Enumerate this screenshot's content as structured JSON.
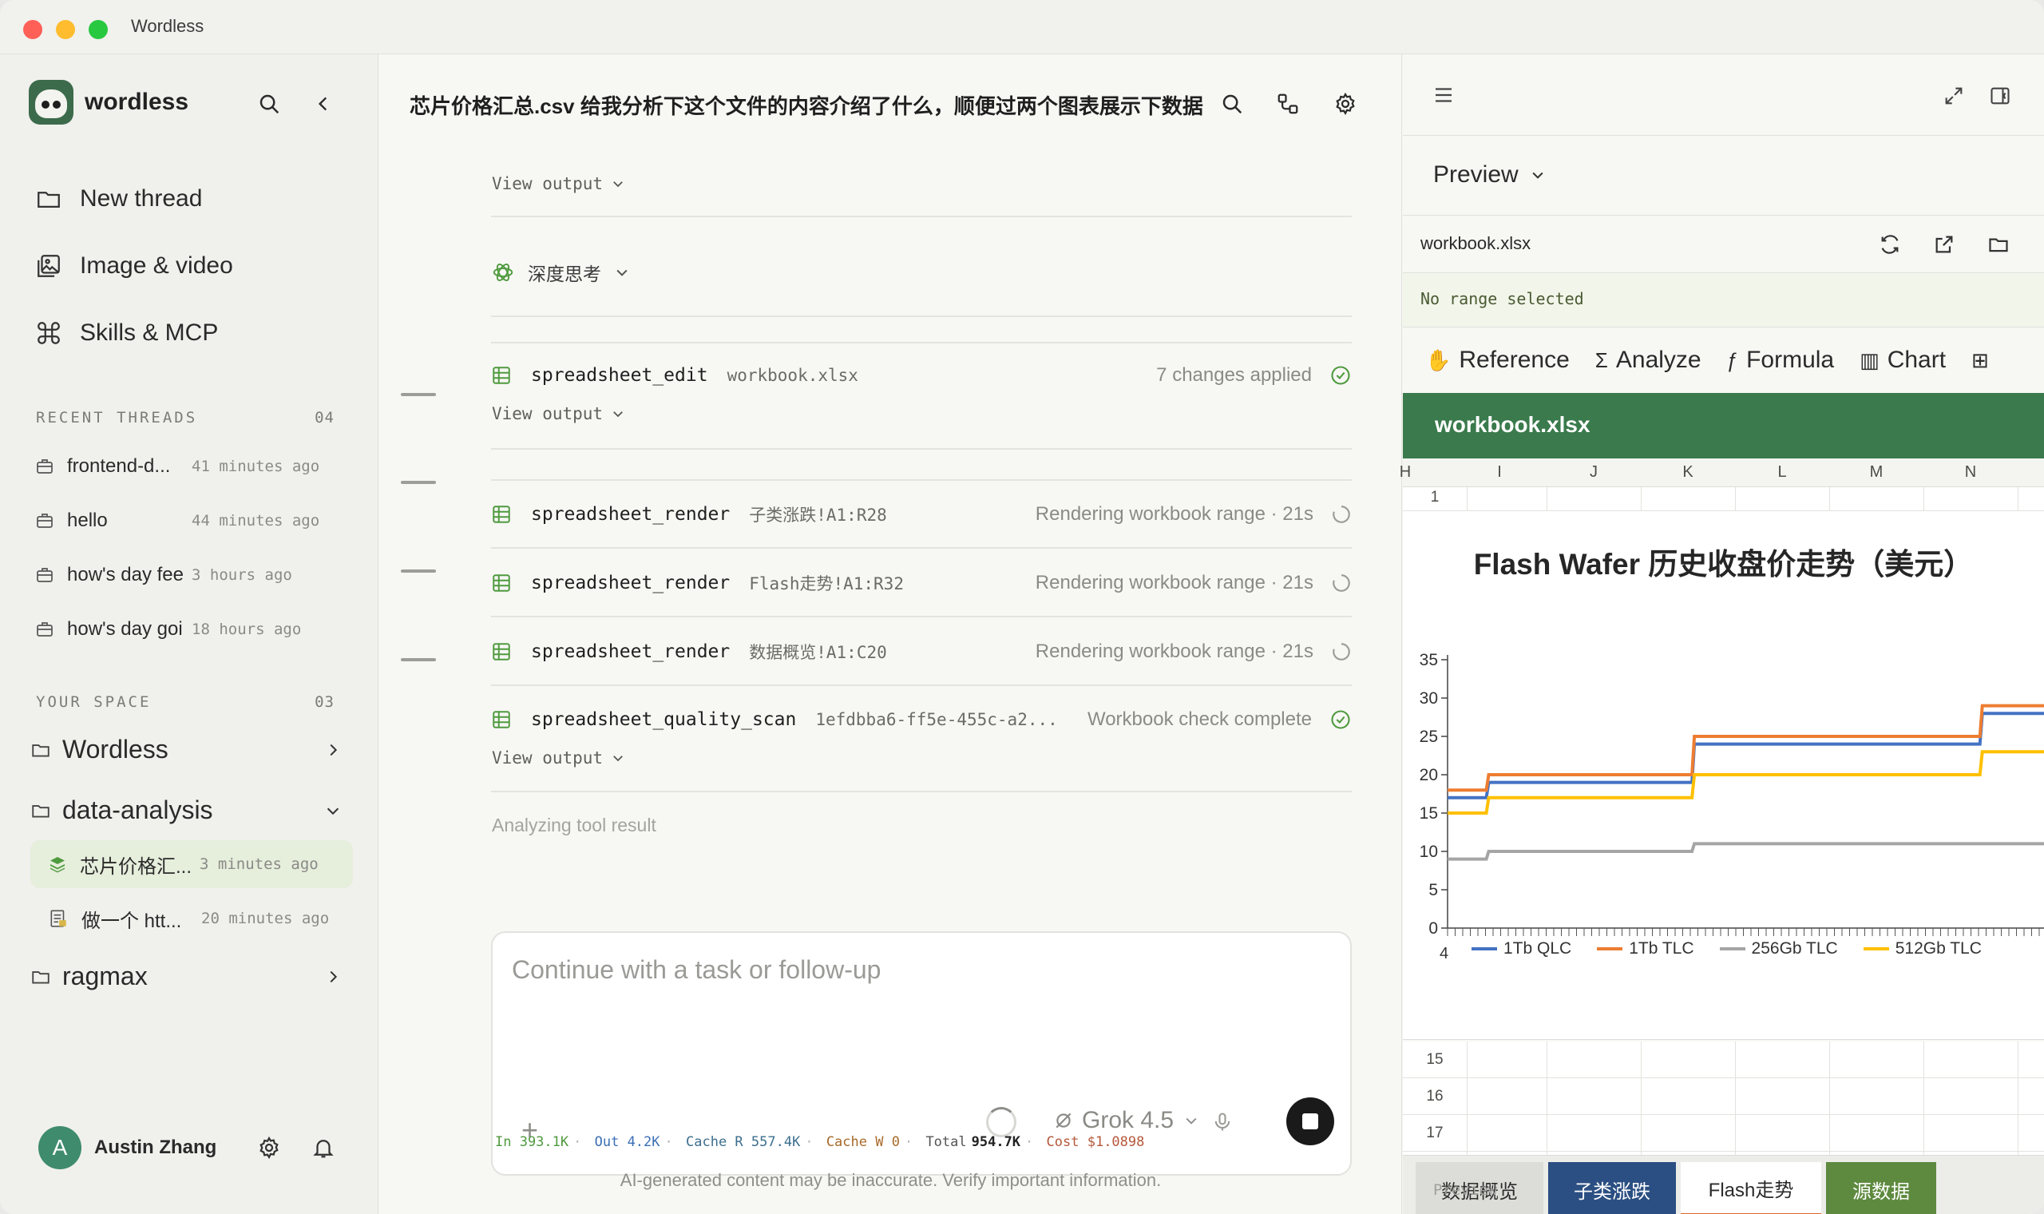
{
  "window": {
    "title": "Wordless"
  },
  "sidebar": {
    "brand": "wordless",
    "nav": [
      {
        "label": "New thread",
        "icon": "folder-icon"
      },
      {
        "label": "Image & video",
        "icon": "image-icon"
      },
      {
        "label": "Skills & MCP",
        "icon": "command-icon"
      }
    ],
    "recent": {
      "heading": "RECENT THREADS",
      "count": "04",
      "items": [
        {
          "name": "frontend-d...",
          "time": "41 minutes ago"
        },
        {
          "name": "hello",
          "time": "44 minutes ago"
        },
        {
          "name": "how's day feeli...",
          "time": "3 hours ago"
        },
        {
          "name": "how's day goi...",
          "time": "18 hours ago"
        }
      ]
    },
    "space": {
      "heading": "YOUR SPACE",
      "count": "03",
      "items": [
        {
          "name": "Wordless"
        },
        {
          "name": "data-analysis"
        },
        {
          "name": "ragmax"
        }
      ],
      "sub": [
        {
          "name": "芯片价格汇...",
          "time": "3 minutes ago"
        },
        {
          "name": "做一个 htt...",
          "time": "20 minutes ago"
        }
      ]
    },
    "user": {
      "initial": "A",
      "name": "Austin Zhang"
    }
  },
  "main": {
    "title": "芯片价格汇总.csv 给我分析下这个文件的内容介绍了什么，顺便过两个图表展示下数据",
    "view_output": "View output",
    "thinking": "深度思考",
    "tools": [
      {
        "name": "spreadsheet_edit",
        "arg": "workbook.xlsx",
        "status": "7 changes applied"
      },
      {
        "name": "spreadsheet_render",
        "arg": "子类涨跌!A1:R28",
        "status": "Rendering workbook range · 21s"
      },
      {
        "name": "spreadsheet_render",
        "arg": "Flash走势!A1:R32",
        "status": "Rendering workbook range · 21s"
      },
      {
        "name": "spreadsheet_render",
        "arg": "数据概览!A1:C20",
        "status": "Rendering workbook range · 21s"
      },
      {
        "name": "spreadsheet_quality_scan",
        "arg": "1efdbba6-ff5e-455c-a2...",
        "status": "Workbook check complete"
      }
    ],
    "analyzing": "Analyzing tool result",
    "composer": {
      "placeholder": "Continue with a task or follow-up",
      "model": "Grok 4.5"
    },
    "stats": {
      "in": "In 393.1K",
      "out": "Out 4.2K",
      "cache_r": "Cache R 557.4K",
      "cache_w": "Cache W 0",
      "total_label": "Total",
      "total_value": "954.7K",
      "cost": "Cost $1.0898"
    },
    "disclaimer": "AI-generated content may be inaccurate. Verify important information."
  },
  "preview": {
    "title": "Preview",
    "file": "workbook.xlsx",
    "range": "No range selected",
    "toolbar": [
      {
        "label": "Reference",
        "icon": "hand-icon"
      },
      {
        "label": "Analyze",
        "icon": "sigma-icon"
      },
      {
        "label": "Formula",
        "icon": "formula-icon"
      },
      {
        "label": "Chart",
        "icon": "chart-icon"
      }
    ],
    "banner": "workbook.xlsx",
    "columns": [
      "H",
      "I",
      "J",
      "K",
      "L",
      "M",
      "N"
    ],
    "row_first": "1",
    "rows_after": [
      "15",
      "16",
      "17"
    ],
    "tabs": [
      {
        "label": "数据概览",
        "bg": "#dcdcd8",
        "fg": "#2b2b2b"
      },
      {
        "label": "子类涨跌",
        "bg": "#2b4f82",
        "fg": "#ffffff"
      },
      {
        "label": "Flash走势",
        "bg": "#ffffff",
        "fg": "#2b2b2b"
      },
      {
        "label": "源数据",
        "bg": "#5e8a3f",
        "fg": "#ffffff"
      }
    ],
    "footer": "Preview"
  },
  "chart_data": {
    "type": "line",
    "title": "Flash Wafer 历史收盘价走势（美元）",
    "ylim": [
      0,
      35
    ],
    "yticks": [
      0,
      5,
      10,
      15,
      20,
      25,
      30,
      35
    ],
    "x_tick_label_first": "4",
    "legend_position": "bottom",
    "grid": false,
    "x": [
      0,
      4,
      8,
      12,
      16,
      20,
      24,
      28,
      32,
      36,
      40,
      44,
      48,
      52,
      56,
      60,
      64,
      68,
      72,
      76,
      80
    ],
    "series": [
      {
        "name": "1Tb QLC",
        "color": "#4472c4",
        "values": [
          17,
          19,
          19,
          19,
          19,
          19,
          24,
          24,
          24,
          24,
          24,
          24,
          24,
          28,
          28,
          28,
          28,
          28,
          28,
          28,
          28
        ]
      },
      {
        "name": "1Tb TLC",
        "color": "#ed7d31",
        "values": [
          18,
          20,
          20,
          20,
          20,
          20,
          25,
          25,
          25,
          25,
          25,
          25,
          25,
          29,
          29,
          29,
          29,
          29,
          29,
          29,
          29
        ]
      },
      {
        "name": "256Gb TLC",
        "color": "#a5a5a5",
        "values": [
          9,
          10,
          10,
          10,
          10,
          10,
          11,
          11,
          11,
          11,
          11,
          11,
          11,
          11,
          11,
          11,
          11,
          11,
          11,
          11,
          11
        ]
      },
      {
        "name": "512Gb TLC",
        "color": "#ffc000",
        "values": [
          15,
          17,
          17,
          17,
          17,
          17,
          20,
          20,
          20,
          20,
          20,
          20,
          20,
          23,
          23,
          23,
          23,
          23,
          23,
          23,
          23
        ]
      }
    ]
  }
}
